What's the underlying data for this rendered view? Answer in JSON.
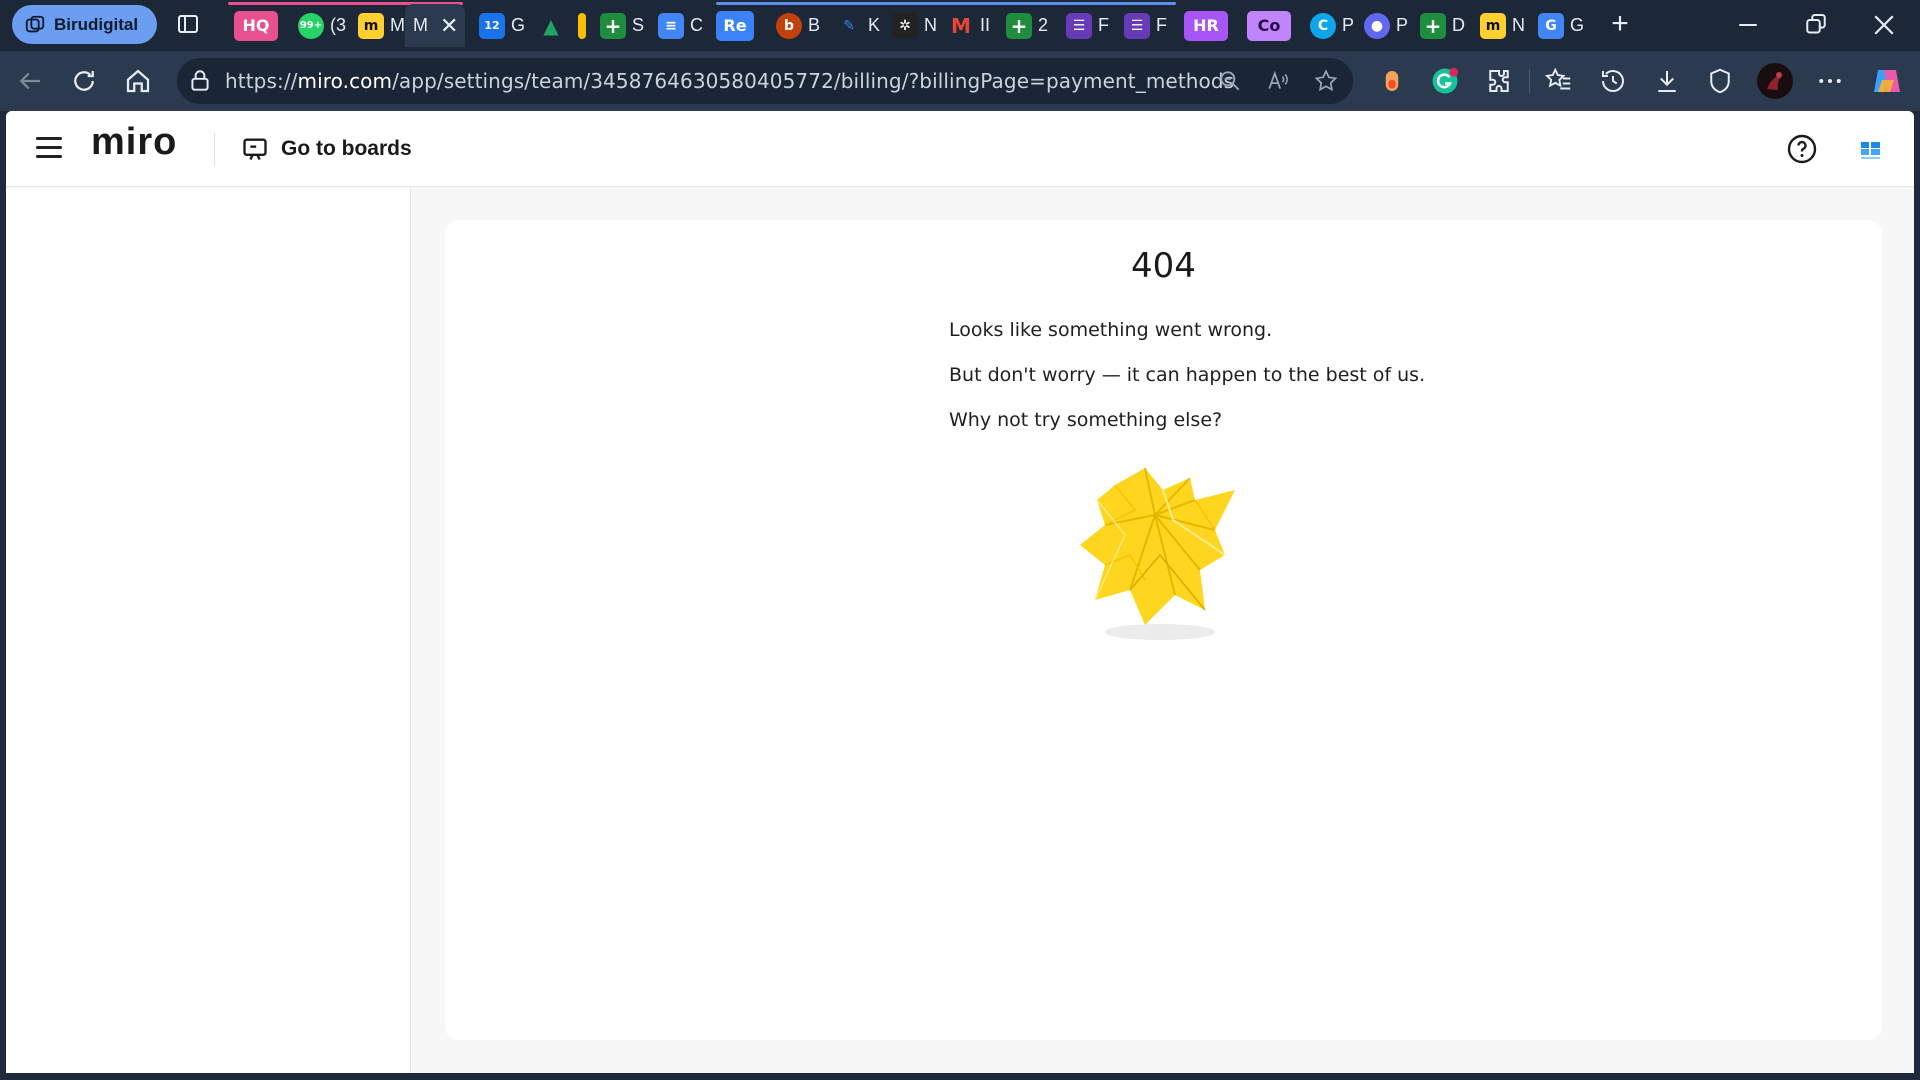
{
  "browser": {
    "profile_name": "Birudigital",
    "tabs": [
      {
        "id": "hq",
        "favicon": "HQ",
        "color": "#e8508f",
        "letter": ""
      },
      {
        "id": "whatsapp",
        "favicon": "99+",
        "color": "#25d366",
        "letter": "(3"
      },
      {
        "id": "miro1",
        "favicon": "m",
        "color": "#ffd02f",
        "letter": "M"
      },
      {
        "id": "miro-active",
        "favicon": "",
        "color": "",
        "letter": "M"
      },
      {
        "id": "calendar",
        "favicon": "12",
        "color": "#1a73e8",
        "letter": "G"
      },
      {
        "id": "drive",
        "favicon": "▲",
        "color": "#1fa463",
        "letter": ""
      },
      {
        "id": "keep",
        "favicon": "",
        "color": "#fbbc04",
        "letter": ""
      },
      {
        "id": "sheets1",
        "favicon": "+",
        "color": "#1e8e3e",
        "letter": "S"
      },
      {
        "id": "docs",
        "favicon": "≡",
        "color": "#4285f4",
        "letter": "C"
      },
      {
        "id": "re",
        "favicon": "Re",
        "color": "#3b82f6",
        "letter": ""
      },
      {
        "id": "b",
        "favicon": "b",
        "color": "#c2410c",
        "letter": "B"
      },
      {
        "id": "k",
        "favicon": "",
        "color": "#3b82f6",
        "letter": "K"
      },
      {
        "id": "n",
        "favicon": "✲",
        "color": "#222222",
        "letter": "N"
      },
      {
        "id": "gmail",
        "favicon": "M",
        "color": "#ea4335",
        "letter": "II"
      },
      {
        "id": "sheets2",
        "favicon": "+",
        "color": "#1e8e3e",
        "letter": "2"
      },
      {
        "id": "forms1",
        "favicon": "☰",
        "color": "#673ab7",
        "letter": "F"
      },
      {
        "id": "forms2",
        "favicon": "☰",
        "color": "#673ab7",
        "letter": "F"
      },
      {
        "id": "hr",
        "favicon": "HR",
        "color": "#a855f7",
        "letter": ""
      },
      {
        "id": "co",
        "favicon": "Co",
        "color": "#c084fc",
        "letter": ""
      },
      {
        "id": "p1",
        "favicon": "C",
        "color": "#0ea5e9",
        "letter": "P"
      },
      {
        "id": "p2",
        "favicon": "●",
        "color": "#6366f1",
        "letter": "P"
      },
      {
        "id": "sheets3",
        "favicon": "+",
        "color": "#1e8e3e",
        "letter": "D"
      },
      {
        "id": "miro2",
        "favicon": "m",
        "color": "#ffd02f",
        "letter": "N"
      },
      {
        "id": "translate",
        "favicon": "G",
        "color": "#4285f4",
        "letter": "G"
      }
    ],
    "url_prefix": "https://",
    "url_host": "miro.com",
    "url_path": "/app/settings/team/3458764630580405772/billing/?billingPage=payment_methods"
  },
  "header": {
    "logo": "miro",
    "go_to_boards": "Go to boards"
  },
  "error": {
    "code": "404",
    "line1": "Looks like something went wrong.",
    "line2": "But don't worry — it can happen to the best of us.",
    "line3": "Why not try something else?"
  },
  "colors": {
    "accent_yellow": "#ffd02f",
    "browser_frame": "#1c2838",
    "page_bg": "#f7f7f8"
  }
}
